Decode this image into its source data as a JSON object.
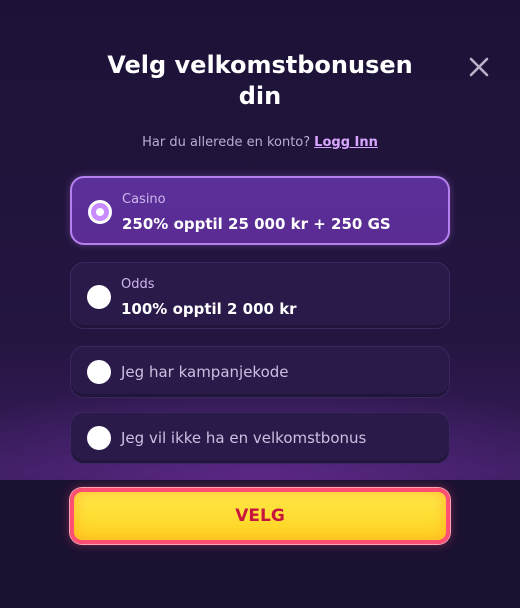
{
  "header": {
    "title": "Velg velkomstbonusen din",
    "close_icon": "close-icon"
  },
  "login": {
    "prompt": "Har du allerede en konto?",
    "link_label": "Logg Inn"
  },
  "options": [
    {
      "category": "Casino",
      "label": "250% opptil 25 000 kr + 250 GS",
      "selected": true
    },
    {
      "category": "Odds",
      "label": "100% opptil 2 000 kr",
      "selected": false
    },
    {
      "label": "Jeg har kampanjekode",
      "selected": false
    },
    {
      "label": "Jeg vil ikke ha en velkomstbonus",
      "selected": false
    }
  ],
  "cta": {
    "label": "VELG"
  },
  "colors": {
    "background": "#1e1338",
    "selected_border": "#b780ef",
    "selected_fill": "#5a2c93",
    "link": "#d9a6ff",
    "cta_fill": "#ffd21f",
    "cta_border": "#ff4f73",
    "cta_text": "#c7163e"
  }
}
